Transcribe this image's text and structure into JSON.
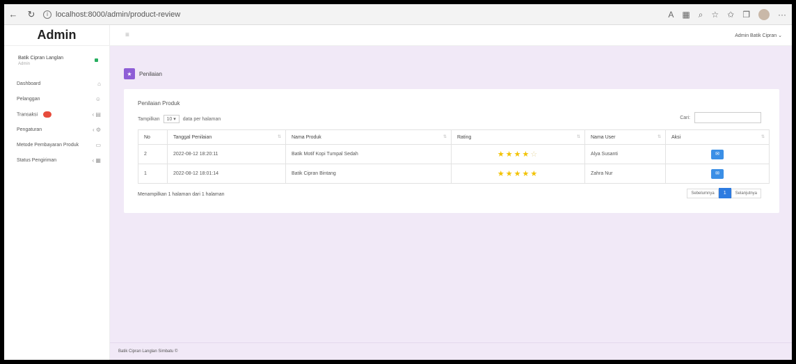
{
  "browser": {
    "url": "localhost:8000/admin/product-review",
    "back_icon": "arrow-left-icon",
    "refresh_icon": "refresh-icon"
  },
  "sidebar": {
    "brand": "Admin",
    "user_name": "Batik Cipran Langlan",
    "user_role": "Admin",
    "items": [
      {
        "label": "Dashboard",
        "icon": "dashboard-icon"
      },
      {
        "label": "Pelanggan",
        "icon": "users-icon"
      },
      {
        "label": "Transaksi",
        "icon": "cart-icon",
        "badge": true
      },
      {
        "label": "Pengaturan",
        "icon": "gear-icon"
      },
      {
        "label": "Metode Pembayaran Produk",
        "icon": "card-icon"
      },
      {
        "label": "Status Pengiriman",
        "icon": "truck-icon"
      }
    ]
  },
  "topbar": {
    "user_menu": "Admin Batik Cipran ⌄"
  },
  "page": {
    "title": "Penilaian",
    "card_title": "Penilaian Produk",
    "show_label": "Tampilkan",
    "show_value": "10",
    "show_suffix": "data per halaman",
    "search_label": "Cari:",
    "search_placeholder": ""
  },
  "table": {
    "headers": [
      "No",
      "Tanggal Penilaian",
      "Nama Produk",
      "Rating",
      "Nama User",
      "Aksi"
    ],
    "rows": [
      {
        "no": "2",
        "date": "2022-08-12 18:20:11",
        "product": "Batik Motif Kopi Tumpal Sedah",
        "rating": 4,
        "user": "Alya Susanti"
      },
      {
        "no": "1",
        "date": "2022-08-12 18:01:14",
        "product": "Batik Cipran Bintang",
        "rating": 5,
        "user": "Zahra Nur"
      }
    ]
  },
  "footer_info": "Menampilkan 1 halaman dari 1 halaman",
  "pagination": {
    "prev": "Sebelumnya",
    "current": "1",
    "next": "Selanjutnya"
  },
  "footer": "Batik Cipran Langlan Simbatu ©",
  "colors": {
    "accent": "#8e5ed6",
    "content_bg": "#f1e9f7",
    "button": "#3b8fe6",
    "star": "#f2c200"
  }
}
